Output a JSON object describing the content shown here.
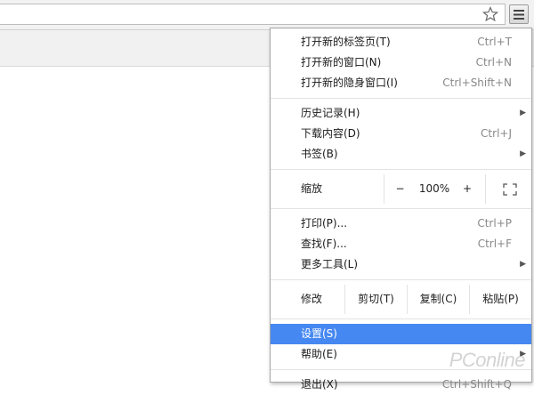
{
  "window": {
    "menu_icon": "hamburger-icon",
    "star_icon": "star-icon"
  },
  "menu": {
    "items": [
      {
        "label": "打开新的标签页(T)",
        "shortcut": "Ctrl+T"
      },
      {
        "label": "打开新的窗口(N)",
        "shortcut": "Ctrl+N"
      },
      {
        "label": "打开新的隐身窗口(I)",
        "shortcut": "Ctrl+Shift+N"
      },
      {
        "label": "历史记录(H)",
        "shortcut": ""
      },
      {
        "label": "下载内容(D)",
        "shortcut": "Ctrl+J"
      },
      {
        "label": "书签(B)",
        "shortcut": ""
      }
    ],
    "zoom": {
      "label": "缩放",
      "minus": "−",
      "value": "100%",
      "plus": "+"
    },
    "tools": [
      {
        "label": "打印(P)...",
        "shortcut": "Ctrl+P"
      },
      {
        "label": "查找(F)...",
        "shortcut": "Ctrl+F"
      },
      {
        "label": "更多工具(L)",
        "shortcut": ""
      }
    ],
    "edit": {
      "label": "修改",
      "cut": "剪切(T)",
      "copy": "复制(C)",
      "paste": "粘贴(P)"
    },
    "settings": {
      "label": "设置(S)"
    },
    "help": {
      "label": "帮助(E)"
    },
    "exit": {
      "label": "退出(X)",
      "shortcut": "Ctrl+Shift+Q"
    },
    "selected_color": "#4688f1"
  },
  "watermark": {
    "text": "PConline"
  }
}
